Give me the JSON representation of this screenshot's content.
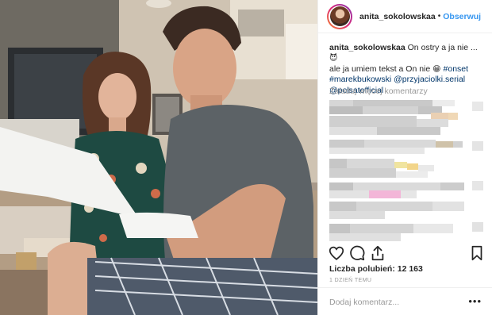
{
  "post": {
    "username": "anita_sokolowskaa",
    "separator": "•",
    "follow_label": "Obserwuj",
    "caption": {
      "username": "anita_sokolowskaa",
      "text_line1": "On ostry a ja nie ...",
      "emoji1": "😈",
      "text_line2": "ale ja umiem tekst a On nie",
      "emoji2": "😁",
      "hashtag_onset": "#onset",
      "hashtag_marek": "#marekbukowski",
      "mention_przyjaciolki": "@przyjaciolki.serial",
      "mention_polsat": "@polsatofficial"
    },
    "load_more_label": "Załaduj więcej komentarzy",
    "likes_text": "Liczba polubień: 12 163",
    "time_text": "1 DZIEŃ TEMU",
    "add_comment_placeholder": "Dodaj komentarz...",
    "more_options": "•••"
  },
  "icons": {
    "avatar": "profile-avatar",
    "like": "heart-icon",
    "comment": "comment-icon",
    "share": "share-icon",
    "save": "bookmark-icon",
    "more": "more-options-icon"
  },
  "colors": {
    "link_blue": "#3897f0",
    "hashtag_blue": "#003569",
    "text": "#262626",
    "muted": "#999999",
    "border": "#efefef"
  }
}
